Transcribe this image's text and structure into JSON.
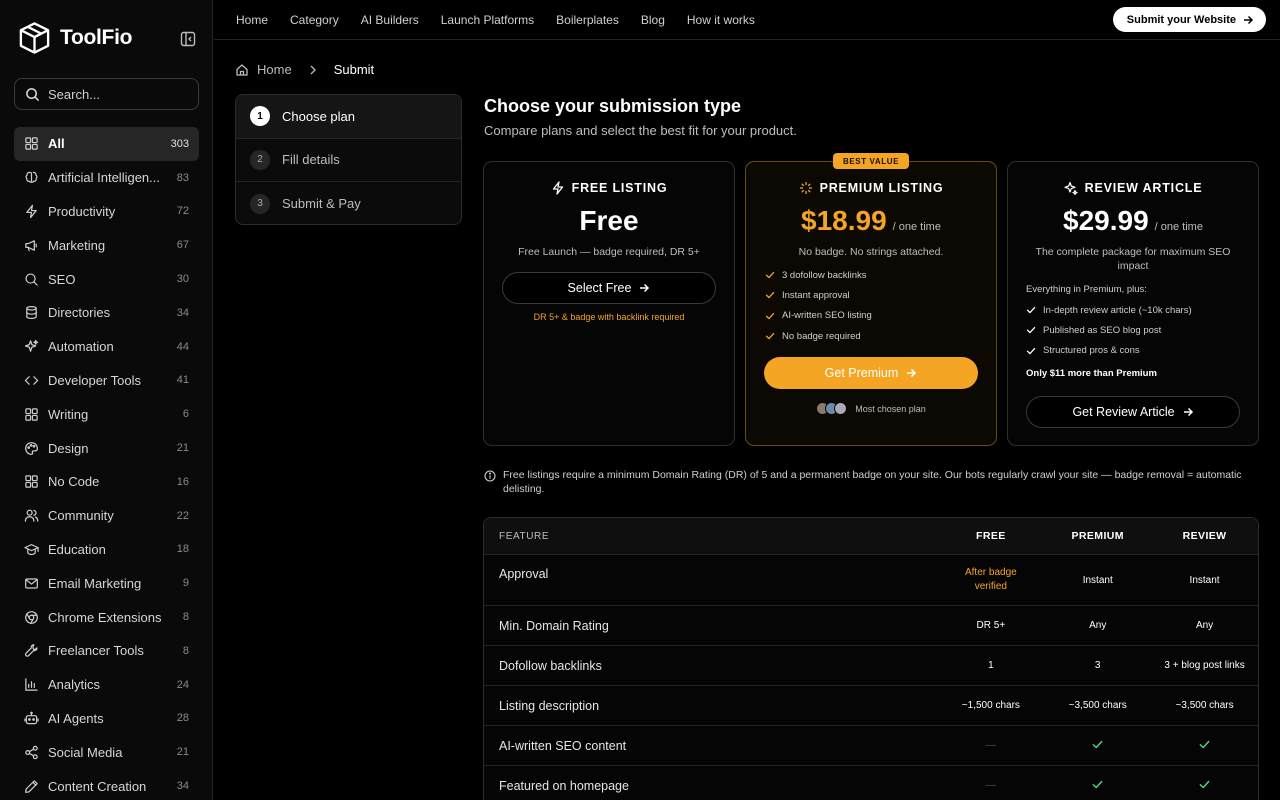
{
  "brand": {
    "name": "ToolFio"
  },
  "search": {
    "placeholder": "Search..."
  },
  "categories": [
    {
      "label": "All",
      "count": "303",
      "icon": "grid-icon",
      "active": true
    },
    {
      "label": "Artificial Intelligen...",
      "count": "83",
      "icon": "brain-icon"
    },
    {
      "label": "Productivity",
      "count": "72",
      "icon": "lightning-icon"
    },
    {
      "label": "Marketing",
      "count": "67",
      "icon": "megaphone-icon"
    },
    {
      "label": "SEO",
      "count": "30",
      "icon": "search-icon"
    },
    {
      "label": "Directories",
      "count": "34",
      "icon": "database-icon"
    },
    {
      "label": "Automation",
      "count": "44",
      "icon": "sparkles-icon"
    },
    {
      "label": "Developer Tools",
      "count": "41",
      "icon": "code-icon"
    },
    {
      "label": "Writing",
      "count": "6",
      "icon": "grid-icon"
    },
    {
      "label": "Design",
      "count": "21",
      "icon": "palette-icon"
    },
    {
      "label": "No Code",
      "count": "16",
      "icon": "grid-icon"
    },
    {
      "label": "Community",
      "count": "22",
      "icon": "users-icon"
    },
    {
      "label": "Education",
      "count": "18",
      "icon": "graduation-cap-icon"
    },
    {
      "label": "Email Marketing",
      "count": "9",
      "icon": "mail-icon"
    },
    {
      "label": "Chrome Extensions",
      "count": "8",
      "icon": "chrome-icon"
    },
    {
      "label": "Freelancer Tools",
      "count": "8",
      "icon": "wrench-icon"
    },
    {
      "label": "Analytics",
      "count": "24",
      "icon": "bar-chart-icon"
    },
    {
      "label": "AI Agents",
      "count": "28",
      "icon": "bot-icon"
    },
    {
      "label": "Social Media",
      "count": "21",
      "icon": "share-icon"
    },
    {
      "label": "Content Creation",
      "count": "34",
      "icon": "pen-icon"
    }
  ],
  "nav": {
    "links": [
      "Home",
      "Category",
      "AI Builders",
      "Launch Platforms",
      "Boilerplates",
      "Blog",
      "How it works"
    ],
    "submit_label": "Submit your Website"
  },
  "breadcrumb": {
    "home": "Home",
    "current": "Submit"
  },
  "steps": [
    {
      "num": "1",
      "label": "Choose plan",
      "active": true
    },
    {
      "num": "2",
      "label": "Fill details"
    },
    {
      "num": "3",
      "label": "Submit & Pay"
    }
  ],
  "heading": {
    "title": "Choose your submission type",
    "subtitle": "Compare plans and select the best fit for your product."
  },
  "plans": {
    "free": {
      "title": "FREE LISTING",
      "price": "Free",
      "desc": "Free Launch — badge required, DR 5+",
      "button": "Select Free",
      "note": "DR 5+ & badge with backlink required"
    },
    "premium": {
      "badge": "BEST VALUE",
      "title": "PREMIUM LISTING",
      "price": "$18.99",
      "per": "/ one time",
      "desc": "No badge. No strings attached.",
      "features": [
        "3 dofollow backlinks",
        "Instant approval",
        "AI-written SEO listing",
        "No badge required"
      ],
      "button": "Get Premium",
      "chosen": "Most chosen plan"
    },
    "review": {
      "title": "REVIEW ARTICLE",
      "price": "$29.99",
      "per": "/ one time",
      "desc": "The complete package for maximum SEO impact",
      "intro": "Everything in Premium, plus:",
      "features": [
        "In-depth review article (~10k chars)",
        "Published as SEO blog post",
        "Structured pros & cons"
      ],
      "more": "Only $11 more than Premium",
      "button": "Get Review Article"
    }
  },
  "info_note": "Free listings require a minimum Domain Rating (DR) of 5 and a permanent badge on your site. Our bots regularly crawl your site — badge removal = automatic delisting.",
  "table": {
    "headers": [
      "FEATURE",
      "FREE",
      "PREMIUM",
      "REVIEW"
    ],
    "rows": [
      {
        "feature": "Approval",
        "free": "After badge verified",
        "premium": "Instant",
        "review": "Instant"
      },
      {
        "feature": "Min. Domain Rating",
        "free": "DR 5+",
        "premium": "Any",
        "review": "Any"
      },
      {
        "feature": "Dofollow backlinks",
        "free": "1",
        "premium": "3",
        "review": "3 + blog post links"
      },
      {
        "feature": "Listing description",
        "free": "~1,500 chars",
        "premium": "~3,500 chars",
        "review": "~3,500 chars"
      },
      {
        "feature": "AI-written SEO content",
        "free": "—",
        "premium": "check",
        "review": "check"
      },
      {
        "feature": "Featured on homepage",
        "free": "—",
        "premium": "check",
        "review": "check"
      }
    ]
  },
  "colors": {
    "accent": "#f5a524",
    "check": "#4ade80",
    "background": "#000000"
  }
}
